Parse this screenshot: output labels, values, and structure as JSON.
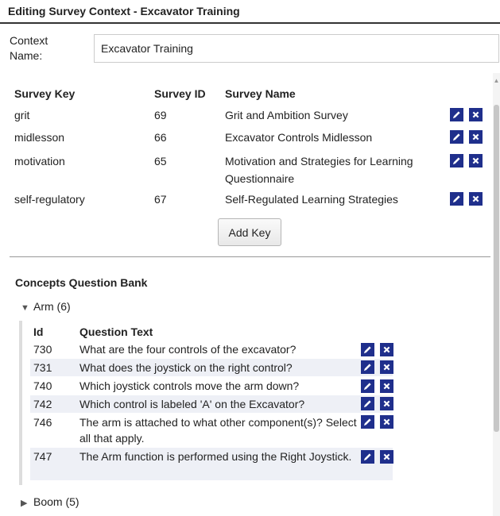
{
  "title": "Editing Survey Context - Excavator Training",
  "context": {
    "label": "Context Name:",
    "value": "Excavator Training"
  },
  "survey_table": {
    "headers": {
      "key": "Survey Key",
      "id": "Survey ID",
      "name": "Survey Name"
    },
    "rows": [
      {
        "key": "grit",
        "id": "69",
        "name": "Grit and Ambition Survey"
      },
      {
        "key": "midlesson",
        "id": "66",
        "name": "Excavator Controls Midlesson"
      },
      {
        "key": "motivation",
        "id": "65",
        "name": "Motivation and Strategies for Learning Questionnaire"
      },
      {
        "key": "self-regulatory",
        "id": "67",
        "name": "Self-Regulated Learning Strategies"
      }
    ],
    "add_key_label": "Add Key"
  },
  "question_bank": {
    "title": "Concepts Question Bank",
    "groups": [
      {
        "label": "Arm (6)",
        "expanded": true
      },
      {
        "label": "Boom (5)",
        "expanded": false
      }
    ],
    "headers": {
      "id": "Id",
      "text": "Question Text"
    },
    "questions": [
      {
        "id": "730",
        "text": "What are the four controls of the excavator?"
      },
      {
        "id": "731",
        "text": "What does the joystick on the right control?"
      },
      {
        "id": "740",
        "text": "Which joystick controls move the arm down?"
      },
      {
        "id": "742",
        "text": "Which control is labeled 'A' on the Excavator?"
      },
      {
        "id": "746",
        "text": "The arm is attached to what other component(s)? Select all that apply."
      },
      {
        "id": "747",
        "text": "The Arm function is performed using the Right Joystick."
      }
    ]
  },
  "icons": {
    "edit": "pencil-icon",
    "delete": "close-icon"
  },
  "colors": {
    "icon_bg": "#1f2f8c",
    "row_shade": "#eef0f6"
  }
}
